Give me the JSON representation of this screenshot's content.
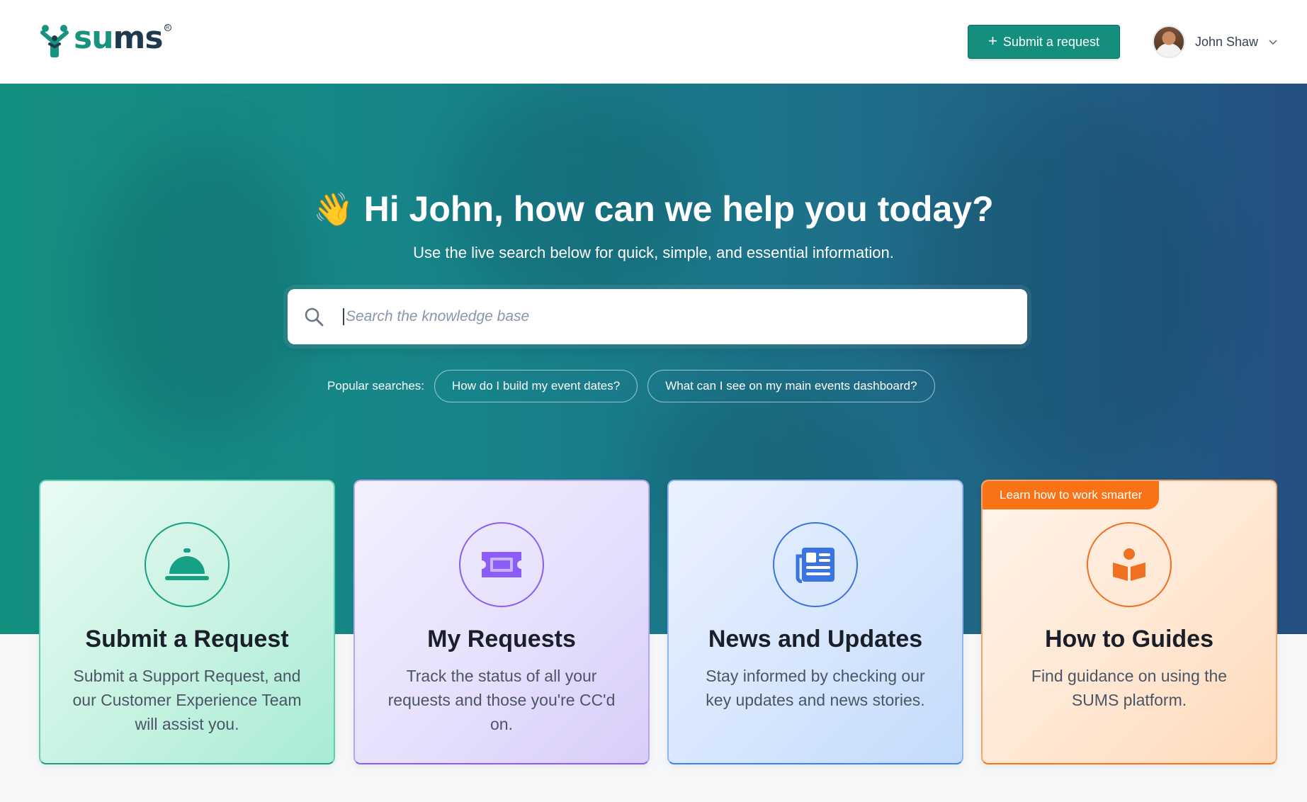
{
  "header": {
    "logo_text_su": "su",
    "logo_text_ms": "ms",
    "logo_reg": "R",
    "submit_button": {
      "icon": "plus-icon",
      "label": "Submit a request"
    },
    "user": {
      "name": "John Shaw",
      "chevron": "chevron-down-icon"
    }
  },
  "hero": {
    "emoji": "👋",
    "title": "Hi John, how can we help you today?",
    "subtitle": "Use the live search below for quick, simple, and essential information.",
    "search": {
      "placeholder": "Search the knowledge base",
      "value": ""
    },
    "popular_label": "Popular searches:",
    "popular_searches": [
      "How do I build my event dates?",
      "What can I see on my main events dashboard?"
    ]
  },
  "cards": [
    {
      "title": "Submit a Request",
      "description": "Submit a Support Request, and our Customer Experience Team will assist you.",
      "icon": "service-bell-icon",
      "color": "#16a085"
    },
    {
      "title": "My Requests",
      "description": "Track the status of all your requests and those you're CC'd on.",
      "icon": "ticket-icon",
      "color": "#8b5cf6"
    },
    {
      "title": "News and Updates",
      "description": "Stay informed by checking our key updates and news stories.",
      "icon": "newspaper-icon",
      "color": "#3b73e0"
    },
    {
      "title": "How to Guides",
      "description": "Find guidance on using the SUMS platform.",
      "icon": "book-reader-icon",
      "color": "#f07022",
      "badge": "Learn how to work smarter"
    }
  ],
  "colors": {
    "brand_green": "#158f7d",
    "hero_start": "#14907f",
    "hero_end": "#244f80",
    "accent_orange": "#f97316"
  }
}
